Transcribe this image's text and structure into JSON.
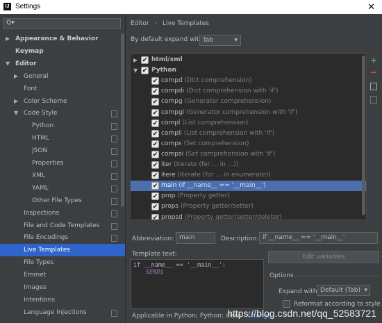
{
  "window": {
    "title": "Settings",
    "close_glyph": "✕",
    "icon_letters": "IJ"
  },
  "search": {
    "icon": "search-icon",
    "value": "Q▾"
  },
  "sidebar": {
    "items": [
      {
        "label": "Appearance & Behavior",
        "arrow": "▶",
        "bold": true,
        "indent": 0
      },
      {
        "label": "Keymap",
        "arrow": "",
        "bold": true,
        "indent": 0
      },
      {
        "label": "Editor",
        "arrow": "▼",
        "bold": true,
        "indent": 0
      },
      {
        "label": "General",
        "arrow": "▶",
        "indent": 1
      },
      {
        "label": "Font",
        "arrow": "",
        "indent": 1
      },
      {
        "label": "Color Scheme",
        "arrow": "▶",
        "indent": 1
      },
      {
        "label": "Code Style",
        "arrow": "▼",
        "indent": 1,
        "copy": true
      },
      {
        "label": "Python",
        "arrow": "",
        "indent": 2,
        "copy": true
      },
      {
        "label": "HTML",
        "arrow": "",
        "indent": 2,
        "copy": true
      },
      {
        "label": "JSON",
        "arrow": "",
        "indent": 2,
        "copy": true
      },
      {
        "label": "Properties",
        "arrow": "",
        "indent": 2,
        "copy": true
      },
      {
        "label": "XML",
        "arrow": "",
        "indent": 2,
        "copy": true
      },
      {
        "label": "YAML",
        "arrow": "",
        "indent": 2,
        "copy": true
      },
      {
        "label": "Other File Types",
        "arrow": "",
        "indent": 2,
        "copy": true
      },
      {
        "label": "Inspections",
        "arrow": "",
        "indent": 1,
        "copy": true
      },
      {
        "label": "File and Code Templates",
        "arrow": "",
        "indent": 1,
        "copy": true
      },
      {
        "label": "File Encodings",
        "arrow": "",
        "indent": 1,
        "copy": true
      },
      {
        "label": "Live Templates",
        "arrow": "",
        "indent": 1,
        "selected": true
      },
      {
        "label": "File Types",
        "arrow": "",
        "indent": 1
      },
      {
        "label": "Emmet",
        "arrow": "",
        "indent": 1
      },
      {
        "label": "Images",
        "arrow": "",
        "indent": 1
      },
      {
        "label": "Intentions",
        "arrow": "",
        "indent": 1
      },
      {
        "label": "Language Injections",
        "arrow": "",
        "indent": 1,
        "copy": true
      }
    ]
  },
  "breadcrumb": {
    "part1": "Editor",
    "sep": "›",
    "part2": "Live Templates"
  },
  "expand": {
    "label": "By default expand with",
    "value": "Tab",
    "arrow": "▾"
  },
  "templates": [
    {
      "group": true,
      "expanded": false,
      "name": "html/xml",
      "checked": true
    },
    {
      "group": true,
      "expanded": true,
      "name": "Python",
      "checked": true
    },
    {
      "abbr": "compd",
      "desc": "(Dict comprehension)",
      "checked": true
    },
    {
      "abbr": "compdi",
      "desc": "(Dict comprehension with 'if')",
      "checked": true
    },
    {
      "abbr": "compg",
      "desc": "(Generator comprehension)",
      "checked": true
    },
    {
      "abbr": "compgi",
      "desc": "(Generator comprehension with 'if')",
      "checked": true
    },
    {
      "abbr": "compl",
      "desc": "(List comprehension)",
      "checked": true
    },
    {
      "abbr": "compli",
      "desc": "(List comprehension with 'if')",
      "checked": true
    },
    {
      "abbr": "comps",
      "desc": "(Set comprehension)",
      "checked": true
    },
    {
      "abbr": "compsi",
      "desc": "(Set comprehension with 'if')",
      "checked": true
    },
    {
      "abbr": "iter",
      "desc": "(Iterate (for ... in ...))",
      "checked": true
    },
    {
      "abbr": "itere",
      "desc": "(Iterate (for ... in enumerate))",
      "checked": true
    },
    {
      "abbr": "main",
      "desc": "(if __name__ == '__main__')",
      "checked": true,
      "selected": true
    },
    {
      "abbr": "prop",
      "desc": "(Property getter)",
      "checked": true
    },
    {
      "abbr": "props",
      "desc": "(Property getter/setter)",
      "checked": true
    },
    {
      "abbr": "propsd",
      "desc": "(Property getter/setter/deleter)",
      "checked": true
    }
  ],
  "toolbar": {
    "add": "+",
    "remove": "−"
  },
  "abbreviation": {
    "label": "Abbreviation:",
    "value": "main"
  },
  "description": {
    "label": "Description:",
    "value": "if __name__ == '__main__'"
  },
  "template_text": {
    "label": "Template text:",
    "line1": "if __name__ == '__main__':",
    "line2": "$END$"
  },
  "edit_variables": "Edit variables",
  "options": {
    "legend": "Options",
    "expand_label": "Expand with",
    "expand_value": "Default (Tab)",
    "reformat": "Reformat according to style"
  },
  "applicable": {
    "text": "Applicable in Python; Python: class.",
    "change": "Change"
  },
  "watermark": "https://blog.csdn.net/qq_52583721"
}
